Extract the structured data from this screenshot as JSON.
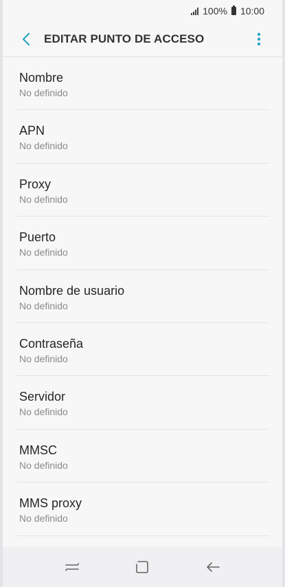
{
  "status_bar": {
    "battery_text": "100%",
    "time": "10:00"
  },
  "app_bar": {
    "title": "EDITAR PUNTO DE ACCESO",
    "back_icon": "chevron-left-icon",
    "menu_icon": "more-vertical-icon"
  },
  "colors": {
    "accent": "#2aa4c4"
  },
  "items": [
    {
      "label": "Nombre",
      "value": "No definido"
    },
    {
      "label": "APN",
      "value": "No definido"
    },
    {
      "label": "Proxy",
      "value": "No definido"
    },
    {
      "label": "Puerto",
      "value": "No definido"
    },
    {
      "label": "Nombre de usuario",
      "value": "No definido"
    },
    {
      "label": "Contraseña",
      "value": "No definido"
    },
    {
      "label": "Servidor",
      "value": "No definido"
    },
    {
      "label": "MMSC",
      "value": "No definido"
    },
    {
      "label": "MMS proxy",
      "value": "No definido"
    }
  ],
  "nav_bar": {
    "recent_icon": "recent-apps-icon",
    "home_icon": "home-icon",
    "back_icon": "back-arrow-icon"
  }
}
